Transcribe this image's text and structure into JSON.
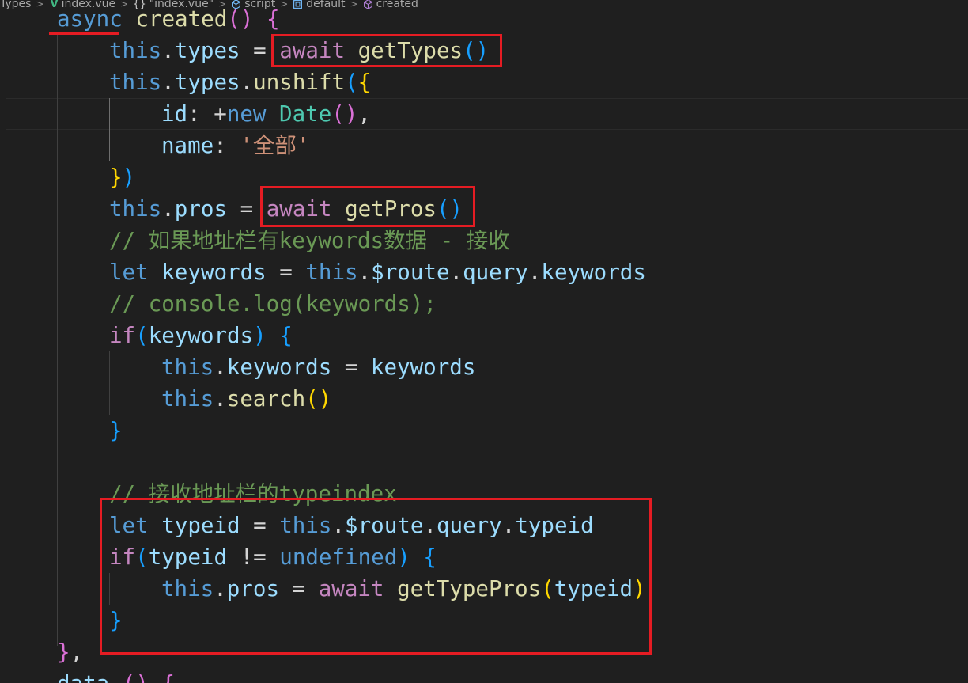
{
  "breadcrumb": {
    "items": [
      {
        "label": "Types"
      },
      {
        "label": "index.vue"
      },
      {
        "label": "\"index.vue\""
      },
      {
        "label": "script"
      },
      {
        "label": "default"
      },
      {
        "label": "created"
      }
    ]
  },
  "code": {
    "lines": [
      {
        "t": [
          [
            "k-blue",
            "async"
          ],
          [
            "op",
            " "
          ],
          [
            "fn",
            "created"
          ],
          [
            "b2",
            "()"
          ],
          [
            "op",
            " "
          ],
          [
            "b2",
            "{"
          ]
        ]
      },
      {
        "t": [
          [
            "k-blue",
            "this"
          ],
          [
            "pn",
            "."
          ],
          [
            "prop",
            "types"
          ],
          [
            "op",
            " = "
          ],
          [
            "k-ctrl",
            "await"
          ],
          [
            "op",
            " "
          ],
          [
            "fn",
            "getTypes"
          ],
          [
            "b3",
            "()"
          ]
        ]
      },
      {
        "t": [
          [
            "k-blue",
            "this"
          ],
          [
            "pn",
            "."
          ],
          [
            "prop",
            "types"
          ],
          [
            "pn",
            "."
          ],
          [
            "fn",
            "unshift"
          ],
          [
            "b3",
            "("
          ],
          [
            "b1",
            "{"
          ]
        ]
      },
      {
        "t": [
          [
            "prop",
            "id"
          ],
          [
            "pn",
            ": "
          ],
          [
            "op",
            "+"
          ],
          [
            "k-blue",
            "new"
          ],
          [
            "op",
            " "
          ],
          [
            "cls",
            "Date"
          ],
          [
            "b2",
            "()"
          ],
          [
            "pn",
            ","
          ]
        ]
      },
      {
        "t": [
          [
            "prop",
            "name"
          ],
          [
            "pn",
            ": "
          ],
          [
            "str",
            "'全部'"
          ]
        ]
      },
      {
        "t": [
          [
            "b1",
            "}"
          ],
          [
            "b3",
            ")"
          ]
        ]
      },
      {
        "t": [
          [
            "k-blue",
            "this"
          ],
          [
            "pn",
            "."
          ],
          [
            "prop",
            "pros"
          ],
          [
            "op",
            " = "
          ],
          [
            "k-ctrl",
            "await"
          ],
          [
            "op",
            " "
          ],
          [
            "fn",
            "getPros"
          ],
          [
            "b3",
            "()"
          ]
        ]
      },
      {
        "t": [
          [
            "cmt",
            "// 如果地址栏有keywords数据 - 接收"
          ]
        ]
      },
      {
        "t": [
          [
            "k-blue",
            "let"
          ],
          [
            "op",
            " "
          ],
          [
            "var",
            "keywords"
          ],
          [
            "op",
            " = "
          ],
          [
            "k-blue",
            "this"
          ],
          [
            "pn",
            "."
          ],
          [
            "var",
            "$route"
          ],
          [
            "pn",
            "."
          ],
          [
            "prop",
            "query"
          ],
          [
            "pn",
            "."
          ],
          [
            "prop",
            "keywords"
          ]
        ]
      },
      {
        "t": [
          [
            "cmt",
            "// console.log(keywords);"
          ]
        ]
      },
      {
        "t": [
          [
            "k-ctrl",
            "if"
          ],
          [
            "b3",
            "("
          ],
          [
            "var",
            "keywords"
          ],
          [
            "b3",
            ")"
          ],
          [
            "op",
            " "
          ],
          [
            "b3",
            "{"
          ]
        ]
      },
      {
        "t": [
          [
            "k-blue",
            "this"
          ],
          [
            "pn",
            "."
          ],
          [
            "prop",
            "keywords"
          ],
          [
            "op",
            " = "
          ],
          [
            "var",
            "keywords"
          ]
        ]
      },
      {
        "t": [
          [
            "k-blue",
            "this"
          ],
          [
            "pn",
            "."
          ],
          [
            "fn",
            "search"
          ],
          [
            "b1",
            "()"
          ]
        ]
      },
      {
        "t": [
          [
            "b3",
            "}"
          ]
        ]
      },
      {
        "t": []
      },
      {
        "t": [
          [
            "cmt",
            "// 接收地址栏的typeindex"
          ]
        ]
      },
      {
        "t": [
          [
            "k-blue",
            "let"
          ],
          [
            "op",
            " "
          ],
          [
            "var",
            "typeid"
          ],
          [
            "op",
            " = "
          ],
          [
            "k-blue",
            "this"
          ],
          [
            "pn",
            "."
          ],
          [
            "var",
            "$route"
          ],
          [
            "pn",
            "."
          ],
          [
            "prop",
            "query"
          ],
          [
            "pn",
            "."
          ],
          [
            "prop",
            "typeid"
          ]
        ]
      },
      {
        "t": [
          [
            "k-ctrl",
            "if"
          ],
          [
            "b3",
            "("
          ],
          [
            "var",
            "typeid"
          ],
          [
            "op",
            " != "
          ],
          [
            "k-blue",
            "undefined"
          ],
          [
            "b3",
            ")"
          ],
          [
            "op",
            " "
          ],
          [
            "b3",
            "{"
          ]
        ]
      },
      {
        "t": [
          [
            "k-blue",
            "this"
          ],
          [
            "pn",
            "."
          ],
          [
            "prop",
            "pros"
          ],
          [
            "op",
            " = "
          ],
          [
            "k-ctrl",
            "await"
          ],
          [
            "op",
            " "
          ],
          [
            "fn",
            "getTypePros"
          ],
          [
            "b1",
            "("
          ],
          [
            "var",
            "typeid"
          ],
          [
            "b1",
            ")"
          ]
        ]
      },
      {
        "t": [
          [
            "b3",
            "}"
          ]
        ]
      },
      {
        "t": [
          [
            "b2",
            "}"
          ],
          [
            "pn",
            ","
          ]
        ]
      },
      {
        "t": [
          [
            "var",
            "data"
          ],
          [
            "op",
            " "
          ],
          [
            "b2",
            "()"
          ],
          [
            "op",
            " "
          ],
          [
            "b2",
            "{"
          ]
        ]
      }
    ]
  },
  "colors": {
    "annotation": "#e51c23",
    "background": "#1f1f1f"
  }
}
